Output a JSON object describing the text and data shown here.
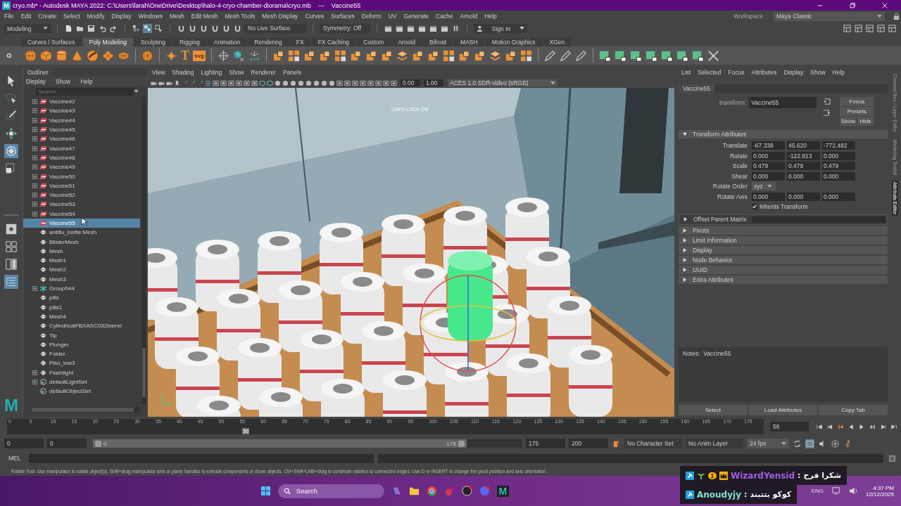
{
  "window": {
    "logo": "M",
    "title": "cryo.mb* - Autodesk MAYA 2022: C:\\Users\\farah\\OneDrive\\Desktop\\halo-4-cryo-chamber-diorama\\cryo.mb    ---    Vaccine55"
  },
  "menus": [
    "File",
    "Edit",
    "Create",
    "Select",
    "Modify",
    "Display",
    "Windows",
    "Mesh",
    "Edit Mesh",
    "Mesh Tools",
    "Mesh Display",
    "Curves",
    "Surfaces",
    "Deform",
    "UV",
    "Generate",
    "Cache",
    "Arnold",
    "Help"
  ],
  "status_line": {
    "mode": "Modeling",
    "live_surface": "No Live Surface",
    "symmetry": "Symmetry: Off",
    "sign_in": "Sign In",
    "workspace_label": "Workspace :",
    "workspace": "Maya Classic"
  },
  "shelf_tabs": [
    {
      "label": "Curves / Surfaces",
      "selected": false
    },
    {
      "label": "Poly Modeling",
      "selected": true
    },
    {
      "label": "Sculpting",
      "selected": false
    },
    {
      "label": "Rigging",
      "selected": false
    },
    {
      "label": "Animation",
      "selected": false
    },
    {
      "label": "Rendering",
      "selected": false
    },
    {
      "label": "FX",
      "selected": false
    },
    {
      "label": "FX Caching",
      "selected": false
    },
    {
      "label": "Custom",
      "selected": false
    },
    {
      "label": "Arnold",
      "selected": false
    },
    {
      "label": "Bifrost",
      "selected": false
    },
    {
      "label": "MASH",
      "selected": false
    },
    {
      "label": "Motion Graphics",
      "selected": false
    },
    {
      "label": "XGen",
      "selected": false
    }
  ],
  "shelf": {
    "text_tool": "T",
    "svg_tool": "svg"
  },
  "toolbox": {
    "tools": [
      {
        "kind": "select",
        "selected": false
      },
      {
        "kind": "lasso",
        "selected": false
      },
      {
        "kind": "paint",
        "selected": false
      },
      {
        "kind": "move",
        "selected": false
      },
      {
        "kind": "rotate",
        "selected": true
      },
      {
        "kind": "scale",
        "selected": false
      }
    ],
    "layouts": [
      {
        "kind": "single",
        "selected": false
      },
      {
        "kind": "quad",
        "selected": false
      },
      {
        "kind": "two",
        "selected": false
      },
      {
        "kind": "list",
        "selected": true
      }
    ],
    "logo": "M"
  },
  "outliner": {
    "title": "Outliner",
    "menus": [
      "Display",
      "Show",
      "Help"
    ],
    "search": {
      "placeholder": "Search..."
    },
    "items": [
      {
        "label": "Vaccine42",
        "kind": "transform",
        "expandable": true,
        "selected": false
      },
      {
        "label": "Vaccine43",
        "kind": "transform",
        "expandable": true,
        "selected": false
      },
      {
        "label": "Vaccine44",
        "kind": "transform",
        "expandable": true,
        "selected": false
      },
      {
        "label": "Vaccine45",
        "kind": "transform",
        "expandable": true,
        "selected": false
      },
      {
        "label": "Vaccine46",
        "kind": "transform",
        "expandable": true,
        "selected": false
      },
      {
        "label": "Vaccine47",
        "kind": "transform",
        "expandable": true,
        "selected": false
      },
      {
        "label": "Vaccine48",
        "kind": "transform",
        "expandable": true,
        "selected": false
      },
      {
        "label": "Vaccine49",
        "kind": "transform",
        "expandable": true,
        "selected": false
      },
      {
        "label": "Vaccine50",
        "kind": "transform",
        "expandable": true,
        "selected": false
      },
      {
        "label": "Vaccine51",
        "kind": "transform",
        "expandable": true,
        "selected": false
      },
      {
        "label": "Vaccine52",
        "kind": "transform",
        "expandable": true,
        "selected": false
      },
      {
        "label": "Vaccine53",
        "kind": "transform",
        "expandable": true,
        "selected": false
      },
      {
        "label": "Vaccine54",
        "kind": "transform",
        "expandable": true,
        "selected": false
      },
      {
        "label": "Vaccine55",
        "kind": "transform",
        "expandable": false,
        "selected": true
      },
      {
        "label": "antiflu_bottle:Mesh",
        "kind": "mesh",
        "expandable": false,
        "selected": false
      },
      {
        "label": "BlisterMesh",
        "kind": "mesh",
        "expandable": false,
        "selected": false
      },
      {
        "label": "Mesh",
        "kind": "mesh",
        "expandable": false,
        "selected": false
      },
      {
        "label": "Mesh1",
        "kind": "mesh",
        "expandable": false,
        "selected": false
      },
      {
        "label": "Mesh2",
        "kind": "mesh",
        "expandable": false,
        "selected": false
      },
      {
        "label": "Mesh3",
        "kind": "mesh",
        "expandable": false,
        "selected": false
      },
      {
        "label": "Group044",
        "kind": "group",
        "expandable": true,
        "selected": false
      },
      {
        "label": "pills",
        "kind": "mesh",
        "expandable": false,
        "selected": false
      },
      {
        "label": "pills1",
        "kind": "mesh",
        "expandable": false,
        "selected": false
      },
      {
        "label": "Mesh4",
        "kind": "mesh",
        "expandable": false,
        "selected": false
      },
      {
        "label": "CylindricalFBXASC032barrel",
        "kind": "mesh",
        "expandable": false,
        "selected": false
      },
      {
        "label": "Tip",
        "kind": "mesh",
        "expandable": false,
        "selected": false
      },
      {
        "label": "Plunger",
        "kind": "mesh",
        "expandable": false,
        "selected": false
      },
      {
        "label": "Folder",
        "kind": "mesh",
        "expandable": false,
        "selected": false
      },
      {
        "label": "Plso_low3",
        "kind": "mesh",
        "expandable": false,
        "selected": false
      },
      {
        "label": "Flashlight",
        "kind": "mesh",
        "expandable": true,
        "selected": false
      },
      {
        "label": "defaultLightSet",
        "kind": "set",
        "expandable": true,
        "selected": false
      },
      {
        "label": "defaultObjectSet",
        "kind": "set",
        "expandable": false,
        "selected": false
      }
    ]
  },
  "viewport": {
    "menus": [
      "View",
      "Shading",
      "Lighting",
      "Show",
      "Renderer",
      "Panels"
    ],
    "exposure": "0.00",
    "gamma": "1.00",
    "color_space": "ACES 1.0 SDR-video (sRGB)",
    "hud": "CAPS LOCK ON"
  },
  "attribute_editor": {
    "menus": [
      "List",
      "Selected",
      "Focus",
      "Attributes",
      "Display",
      "Show",
      "Help"
    ],
    "tab": "Vaccine55",
    "node_type_label": "transform:",
    "node_name": "Vaccine55",
    "buttons": [
      "Focus",
      "Presets"
    ],
    "toggle_buttons": [
      "Show",
      "Hide"
    ],
    "sections": [
      {
        "title": "Transform Attributes",
        "expanded": true,
        "kind": "plain"
      },
      {
        "title": "Offset Parent Matrix",
        "expanded": false,
        "kind": "matrix"
      },
      {
        "title": "Pivots",
        "expanded": false,
        "kind": "plain"
      },
      {
        "title": "Limit Information",
        "expanded": false,
        "kind": "plain"
      },
      {
        "title": "Display",
        "expanded": false,
        "kind": "plain"
      },
      {
        "title": "Node Behavior",
        "expanded": false,
        "kind": "plain"
      },
      {
        "title": "UUID",
        "expanded": false,
        "kind": "plain"
      },
      {
        "title": "Extra Attributes",
        "expanded": false,
        "kind": "plain"
      }
    ],
    "rows": [
      {
        "kind": "vector",
        "label": "Translate",
        "values": [
          "-67.338",
          "45.620",
          "-772.482"
        ]
      },
      {
        "kind": "vector",
        "label": "Rotate",
        "values": [
          "0.000",
          "-122.913",
          "0.000"
        ]
      },
      {
        "kind": "vector",
        "label": "Scale",
        "values": [
          "0.479",
          "0.479",
          "0.479"
        ]
      },
      {
        "kind": "vector",
        "label": "Shear",
        "values": [
          "0.000",
          "0.000",
          "0.000"
        ]
      },
      {
        "kind": "dropdown",
        "label": "Rotate Order",
        "value": "xyz"
      },
      {
        "kind": "vector",
        "label": "Rotate Axis",
        "values": [
          "0.000",
          "0.000",
          "0.000"
        ]
      },
      {
        "kind": "checkbox",
        "label": "Inherits Transform",
        "checked": true
      }
    ],
    "notes": "Notes:  Vaccine55",
    "bottom_buttons": [
      "Select",
      "Load Attributes",
      "Copy Tab"
    ],
    "side_tabs": [
      {
        "label": "Channel Box / Layer Editor",
        "selected": false
      },
      {
        "label": "Modeling Toolkit",
        "selected": false
      },
      {
        "label": "Attribute Editor",
        "selected": true
      }
    ]
  },
  "time_slider": {
    "ticks": [
      "0",
      "5",
      "10",
      "15",
      "20",
      "25",
      "30",
      "35",
      "40",
      "45",
      "50",
      "55",
      "60",
      "65",
      "70",
      "75",
      "80",
      "85",
      "90",
      "95",
      "100",
      "105",
      "110",
      "115",
      "120",
      "125",
      "130",
      "135",
      "140",
      "145",
      "150",
      "155",
      "160",
      "165",
      "170",
      "175"
    ],
    "level": 0.32,
    "marker": "56",
    "current_frame": "56"
  },
  "range": {
    "level": 0.87,
    "start": "0",
    "playback_start": "0",
    "slider_start": "0",
    "slider_end": "175",
    "playback_end": "175",
    "end": "200",
    "character_set": "No Character Set",
    "anim_layer": "No Anim Layer",
    "fps": "24 fps"
  },
  "command_line": {
    "label": "MEL"
  },
  "help_line": "Rotate Tool: Use manipulator to rotate object(s). Shift+drag manipulator axis or plane handles to extrude components or clone objects. Ctrl+Shift+LMB+drag to constrain rotation to connected edges. Use D or INSERT to change the pivot position and axis orientation.",
  "chat": [
    {
      "user": "WizardYensid",
      "separator": ":",
      "message": "شكرا فرح",
      "color": "#a45ee5",
      "badge": "1"
    },
    {
      "user": "Anoudyjy",
      "separator": ":",
      "message": "كوكو بتتبند",
      "color": "#7fe0d0"
    }
  ],
  "taskbar": {
    "search": "Search",
    "maya_letter": "M",
    "language": "ENG",
    "time": "4:37 PM",
    "date": "12/12/2025"
  }
}
